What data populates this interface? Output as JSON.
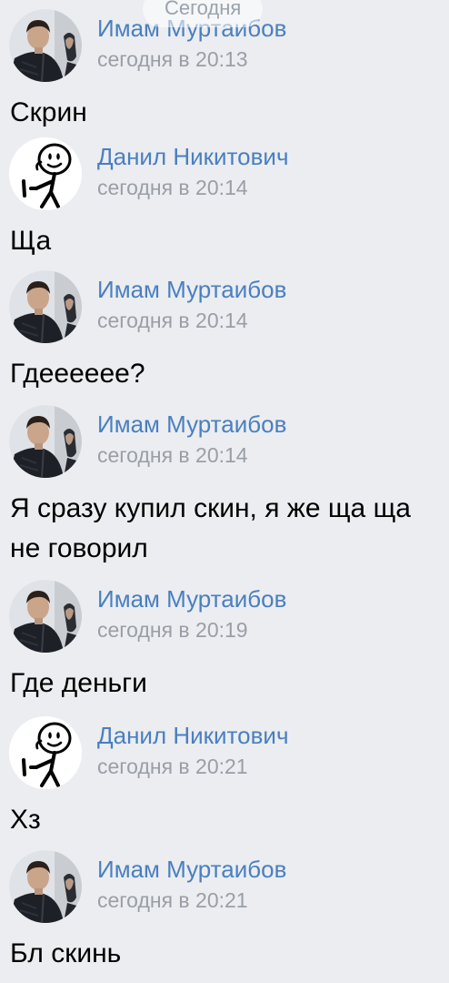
{
  "date_pill": "Сегодня",
  "colors": {
    "background": "#ebedf0",
    "author": "#4a7fc0",
    "time": "#9a9ea6",
    "text": "#000000"
  },
  "messages": [
    {
      "author": "Имам Муртаибов",
      "time": "сегодня в 20:13",
      "text": "Скрин",
      "avatar": "photo-avatar"
    },
    {
      "author": "Данил Никитович",
      "time": "сегодня в 20:14",
      "text": "Ща",
      "avatar": "stick-figure-avatar"
    },
    {
      "author": "Имам Муртаибов",
      "time": "сегодня в 20:14",
      "text": "Гдееееее?",
      "avatar": "photo-avatar"
    },
    {
      "author": "Имам Муртаибов",
      "time": "сегодня в 20:14",
      "text": "Я сразу купил скин, я же ща ща не говорил",
      "avatar": "photo-avatar"
    },
    {
      "author": "Имам Муртаибов",
      "time": "сегодня в 20:19",
      "text": "Где деньги",
      "avatar": "photo-avatar"
    },
    {
      "author": "Данил Никитович",
      "time": "сегодня в 20:21",
      "text": "Хз",
      "avatar": "stick-figure-avatar"
    },
    {
      "author": "Имам Муртаибов",
      "time": "сегодня в 20:21",
      "text": "Бл скинь",
      "avatar": "photo-avatar"
    }
  ]
}
